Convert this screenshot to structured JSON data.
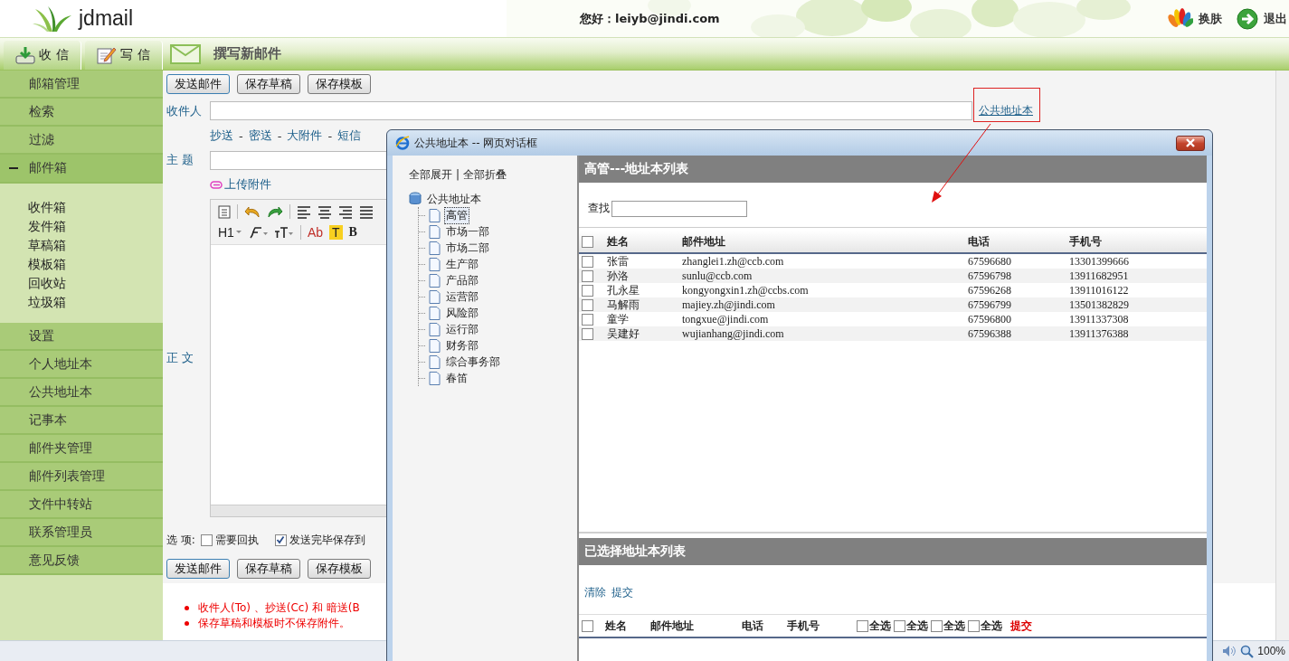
{
  "header": {
    "logo": "jdmail",
    "greeting": "您好：leiyb@jindi.com",
    "actions": [
      {
        "kind": "skin",
        "label": "换肤"
      },
      {
        "kind": "logout",
        "label": "退出"
      }
    ]
  },
  "tabs": [
    {
      "kind": "inbox",
      "label": "收 信"
    },
    {
      "kind": "compose",
      "label": "写 信"
    }
  ],
  "page_title": "撰写新邮件",
  "sidebar": {
    "items": [
      {
        "label": "邮箱管理"
      },
      {
        "label": "检索"
      },
      {
        "label": "过滤"
      },
      {
        "label": "邮件箱",
        "expanded": true,
        "children": [
          "收件箱",
          "发件箱",
          "草稿箱",
          "模板箱",
          "回收站",
          "垃圾箱"
        ]
      },
      {
        "label": "设置"
      },
      {
        "label": "个人地址本"
      },
      {
        "label": "公共地址本"
      },
      {
        "label": "记事本"
      },
      {
        "label": "邮件夹管理"
      },
      {
        "label": "邮件列表管理"
      },
      {
        "label": "文件中转站"
      },
      {
        "label": "联系管理员"
      },
      {
        "label": "意见反馈"
      }
    ]
  },
  "compose": {
    "buttons_top": [
      "发送邮件",
      "保存草稿",
      "保存模板"
    ],
    "recipient_label": "收件人",
    "address_book_link": "公共地址本",
    "extra_links": [
      "抄送",
      "密送",
      "大附件",
      "短信"
    ],
    "link_separator": "-",
    "subject_label": "主 题",
    "attach_link": "上传附件",
    "body_label": "正 文",
    "editor_labels": [
      "H1",
      "Ab",
      "T",
      "B"
    ],
    "options_label": "选 项:",
    "options": [
      {
        "label": "需要回执",
        "checked": false
      },
      {
        "label": "发送完毕保存到",
        "checked": true
      }
    ],
    "buttons_bottom": [
      "发送邮件",
      "保存草稿",
      "保存模板"
    ],
    "tips": [
      "收件人(To) 、抄送(Cc) 和 暗送(B",
      "保存草稿和模板时不保存附件。"
    ]
  },
  "status_bar": {
    "zoom": "100%"
  },
  "dialog": {
    "title": "公共地址本 -- 网页对话框",
    "tree": {
      "expand_all": "全部展开",
      "divider": "|",
      "collapse_all": "全部折叠",
      "root": "公共地址本",
      "children": [
        {
          "label": "高管",
          "selected": true
        },
        {
          "label": "市场一部",
          "selected": false
        },
        {
          "label": "市场二部",
          "selected": false
        },
        {
          "label": "生产部",
          "selected": false
        },
        {
          "label": "产品部",
          "selected": false
        },
        {
          "label": "运营部",
          "selected": false
        },
        {
          "label": "风险部",
          "selected": false
        },
        {
          "label": "运行部",
          "selected": false
        },
        {
          "label": "财务部",
          "selected": false
        },
        {
          "label": "综合事务部",
          "selected": false
        },
        {
          "label": "春笛",
          "selected": false
        }
      ]
    },
    "list": {
      "title": "高管---地址本列表",
      "search_label": "查找",
      "header_checked": false,
      "columns": [
        "姓名",
        "邮件地址",
        "电话",
        "手机号"
      ],
      "rows": [
        {
          "checked": false,
          "name": "张雷",
          "email": "zhanglei1.zh@ccb.com",
          "phone": "67596680",
          "mobile": "13301399666"
        },
        {
          "checked": false,
          "name": "孙洛",
          "email": "sunlu@ccb.com",
          "phone": "67596798",
          "mobile": "13911682951"
        },
        {
          "checked": false,
          "name": "孔永星",
          "email": "kongyongxin1.zh@ccbs.com",
          "phone": "67596268",
          "mobile": "13911016122"
        },
        {
          "checked": false,
          "name": "马解雨",
          "email": "majiey.zh@jindi.com",
          "phone": "67596799",
          "mobile": "13501382829"
        },
        {
          "checked": false,
          "name": "童学",
          "email": "tongxue@jindi.com",
          "phone": "67596800",
          "mobile": "13911337308"
        },
        {
          "checked": false,
          "name": "吴建好",
          "email": "wujianhang@jindi.com",
          "phone": "67596388",
          "mobile": "13911376388"
        }
      ]
    },
    "selected_list": {
      "title": "已选择地址本列表",
      "actions": [
        "清除",
        "提交"
      ],
      "header_checked": false,
      "columns": [
        "姓名",
        "邮件地址",
        "电话",
        "手机号"
      ],
      "select_all": [
        {
          "label": "全选",
          "checked": false
        },
        {
          "label": "全选",
          "checked": false
        },
        {
          "label": "全选",
          "checked": false
        },
        {
          "label": "全选",
          "checked": false
        }
      ],
      "submit": "提交"
    }
  }
}
